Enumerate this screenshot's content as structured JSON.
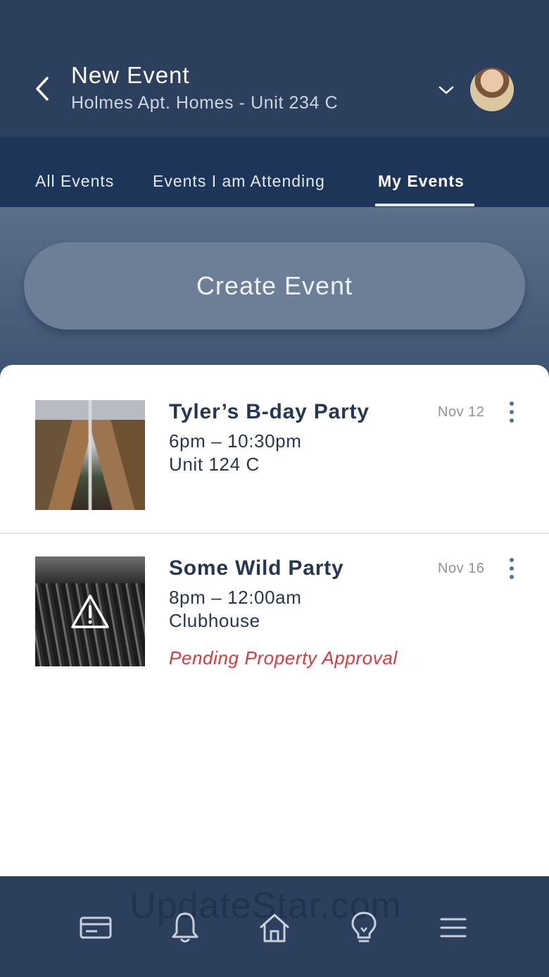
{
  "header": {
    "title": "New Event",
    "subtitle": "Holmes Apt. Homes - Unit 234 C",
    "back_icon": "chevron-left-icon",
    "dropdown_icon": "chevron-down-icon",
    "avatar": "user-avatar"
  },
  "tabs": [
    {
      "label": "All Events",
      "active": false
    },
    {
      "label": "Events I am Attending",
      "active": false
    },
    {
      "label": "My Events",
      "active": true
    }
  ],
  "create_button": {
    "label": "Create Event"
  },
  "events": [
    {
      "title": "Tyler’s B-day Party",
      "time": "6pm – 10:30pm",
      "location": "Unit 124 C",
      "date": "Nov 12",
      "status": ""
    },
    {
      "title": "Some Wild Party",
      "time": "8pm – 12:00am",
      "location": "Clubhouse",
      "date": "Nov 16",
      "status": "Pending Property Approval"
    }
  ],
  "bottom_nav": {
    "items": [
      "card-icon",
      "bell-icon",
      "home-icon",
      "lightbulb-icon",
      "menu-icon"
    ],
    "watermark": "UpdateStar.com"
  },
  "colors": {
    "header_bg": "#2c405e",
    "tabs_bg": "#1d3558",
    "button_bg": "#6d7f97",
    "title_text": "#26374f",
    "status_red": "#d93a3f"
  }
}
